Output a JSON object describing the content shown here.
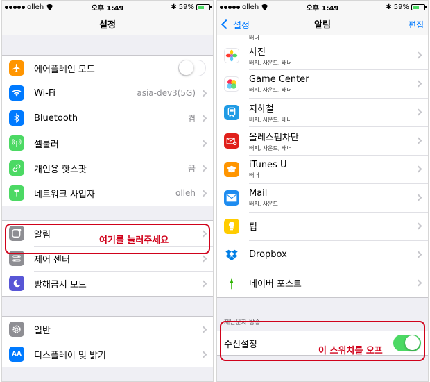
{
  "left_panel": {
    "status": {
      "carrier": "olleh",
      "time": "오후 1:49",
      "battery": "59%",
      "battery_level": 0.59
    },
    "nav_title": "설정",
    "groups": [
      [
        {
          "label": "에어플레인 모드",
          "icon": "airplane-icon",
          "color": "#ff9500",
          "toggle": false
        },
        {
          "label": "Wi-Fi",
          "icon": "wifi-icon",
          "color": "#007aff",
          "value": "asia-dev3(5G)"
        },
        {
          "label": "Bluetooth",
          "icon": "bluetooth-icon",
          "color": "#007aff",
          "value": "켬"
        },
        {
          "label": "셀룰러",
          "icon": "cellular-icon",
          "color": "#4cd964"
        },
        {
          "label": "개인용 핫스팟",
          "icon": "hotspot-icon",
          "color": "#4cd964",
          "value": "끔"
        },
        {
          "label": "네트워크 사업자",
          "icon": "carrier-icon",
          "color": "#4cd964",
          "value": "olleh"
        }
      ],
      [
        {
          "label": "알림",
          "icon": "notifications-icon",
          "color": "#8e8e93"
        },
        {
          "label": "제어 센터",
          "icon": "control-center-icon",
          "color": "#8e8e93"
        },
        {
          "label": "방해금지 모드",
          "icon": "do-not-disturb-icon",
          "color": "#5856d6"
        }
      ],
      [
        {
          "label": "일반",
          "icon": "gear-icon",
          "color": "#8e8e93"
        },
        {
          "label": "디스플레이 및 밝기",
          "icon": "display-icon",
          "color": "#007aff"
        }
      ]
    ],
    "annotation": "여기를 눌러주세요"
  },
  "right_panel": {
    "status": {
      "carrier": "olleh",
      "time": "오후 1:49",
      "battery": "59%",
      "battery_level": 0.59
    },
    "nav_back": "설정",
    "nav_title": "알림",
    "nav_right": "편집",
    "partial_top_sub": "배너",
    "apps": [
      {
        "title": "사진",
        "sub": "배지, 사운드, 배너",
        "icon": "photos-icon"
      },
      {
        "title": "Game Center",
        "sub": "배지, 사운드, 배너",
        "icon": "game-center-icon"
      },
      {
        "title": "지하철",
        "sub": "배지, 사운드, 배너",
        "icon": "subway-icon"
      },
      {
        "title": "올레스팸차단",
        "sub": "배지, 사운드, 배너",
        "icon": "spam-block-icon"
      },
      {
        "title": "iTunes U",
        "sub": "배너",
        "icon": "itunes-u-icon"
      },
      {
        "title": "Mail",
        "sub": "배지, 사운드",
        "icon": "mail-icon"
      },
      {
        "title": "팁",
        "sub": "",
        "icon": "tips-icon"
      },
      {
        "title": "Dropbox",
        "sub": "",
        "icon": "dropbox-icon"
      },
      {
        "title": "네이버 포스트",
        "sub": "",
        "icon": "naver-post-icon"
      }
    ],
    "section_header": "재난문자 방송",
    "receive_label": "수신설정",
    "receive_on": true,
    "annotation": "이 스위치를 오프"
  },
  "colors": {
    "accent": "#007aff",
    "highlight": "#d0021b",
    "toggle_on": "#4cd964"
  }
}
